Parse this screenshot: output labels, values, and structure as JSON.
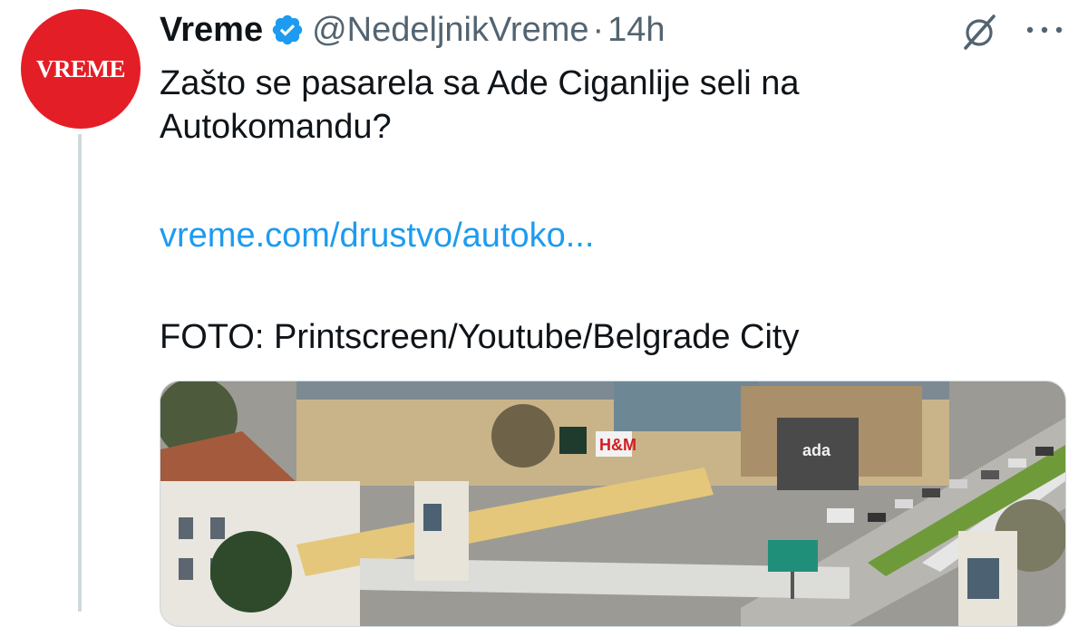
{
  "tweet": {
    "avatar": {
      "text": "VREME",
      "color": "#e41e26"
    },
    "display_name": "Vreme",
    "verified_icon": "verified-badge-icon",
    "handle": "@NedeljnikVreme",
    "separator": "·",
    "time": "14h",
    "text": "Zašto se pasarela sa Ade Ciganlije seli na Autokomandu?",
    "link": "vreme.com/drustvo/autoko...",
    "photo_credit": "FOTO: Printscreen/Youtube/Belgrade City",
    "media": {
      "description_icon": "image",
      "store_signs": [
        "H&M",
        "ada"
      ]
    }
  },
  "actions": {
    "grok_icon": "grok-icon",
    "more_icon": "more-icon"
  },
  "colors": {
    "text": "#0f1419",
    "secondary": "#536471",
    "link": "#1d9bf0",
    "verified": "#1d9bf0",
    "brand": "#e41e26"
  }
}
